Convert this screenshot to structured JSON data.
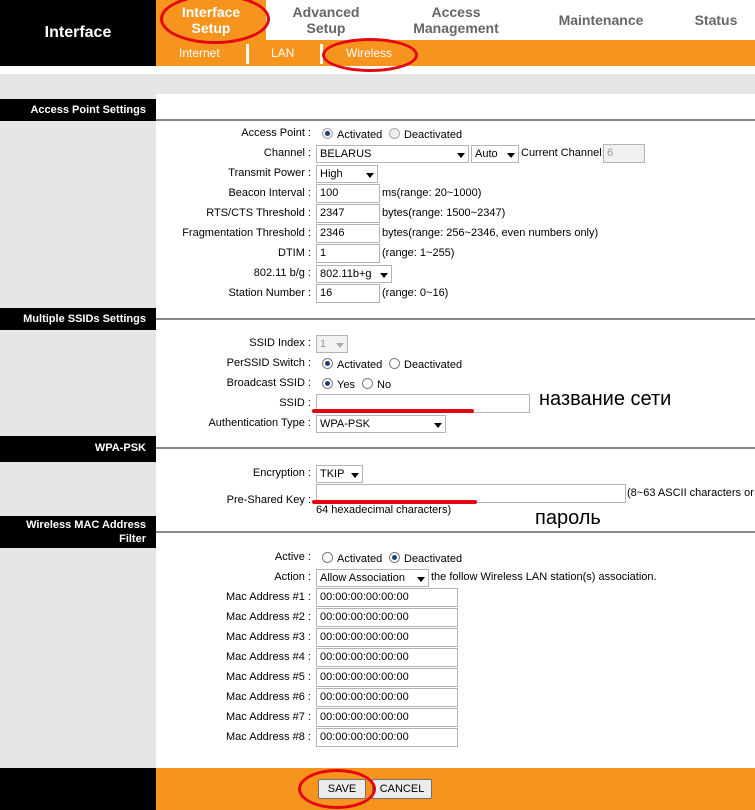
{
  "header": {
    "brand": "Interface",
    "tabs": [
      "Interface Setup",
      "Advanced Setup",
      "Access Management",
      "Maintenance",
      "Status"
    ],
    "tab_lines": [
      [
        "Interface",
        "Setup"
      ],
      [
        "Advanced",
        "Setup"
      ],
      [
        "Access",
        "Management"
      ],
      [
        "Maintenance"
      ],
      [
        "Status"
      ]
    ],
    "subtabs": [
      "Internet",
      "LAN",
      "Wireless"
    ]
  },
  "access_point": {
    "section_title": "Access Point Settings",
    "access_point_label": "Access Point :",
    "activated": "Activated",
    "deactivated": "Deactivated",
    "channel_label": "Channel :",
    "channel_region": "BELARUS",
    "channel_value": "Auto",
    "current_channel_label": "Current Channel:",
    "current_channel_value": "6",
    "transmit_power_label": "Transmit Power :",
    "transmit_power_value": "High",
    "beacon_label": "Beacon Interval :",
    "beacon_value": "100",
    "beacon_note": "ms(range: 20~1000)",
    "rts_label": "RTS/CTS Threshold :",
    "rts_value": "2347",
    "rts_note": "bytes(range: 1500~2347)",
    "frag_label": "Fragmentation Threshold :",
    "frag_value": "2346",
    "frag_note": "bytes(range: 256~2346, even numbers only)",
    "dtim_label": "DTIM :",
    "dtim_value": "1",
    "dtim_note": "(range: 1~255)",
    "mode_label": "802.11 b/g :",
    "mode_value": "802.11b+g",
    "station_label": "Station Number :",
    "station_value": "16",
    "station_note": "(range: 0~16)"
  },
  "ssid": {
    "section_title": "Multiple SSIDs Settings",
    "index_label": "SSID Index :",
    "index_value": "1",
    "switch_label": "PerSSID Switch :",
    "activated": "Activated",
    "deactivated": "Deactivated",
    "broadcast_label": "Broadcast SSID :",
    "yes": "Yes",
    "no": "No",
    "ssid_label": "SSID :",
    "ssid_value": "",
    "auth_label": "Authentication Type :",
    "auth_value": "WPA-PSK"
  },
  "wpa": {
    "section_title": "WPA-PSK",
    "encryption_label": "Encryption :",
    "encryption_value": "TKIP",
    "psk_label": "Pre-Shared Key :",
    "psk_value": "",
    "psk_note_1": "(8~63 ASCII characters or",
    "psk_note_2": "64 hexadecimal characters)"
  },
  "mac_filter": {
    "section_title_1": "Wireless MAC Address",
    "section_title_2": "Filter",
    "active_label": "Active :",
    "activated": "Activated",
    "deactivated": "Deactivated",
    "action_label": "Action :",
    "action_value": "Allow Association",
    "action_note": "the follow Wireless LAN station(s) association.",
    "addresses": [
      {
        "label": "Mac Address #1 :",
        "value": "00:00:00:00:00:00"
      },
      {
        "label": "Mac Address #2 :",
        "value": "00:00:00:00:00:00"
      },
      {
        "label": "Mac Address #3 :",
        "value": "00:00:00:00:00:00"
      },
      {
        "label": "Mac Address #4 :",
        "value": "00:00:00:00:00:00"
      },
      {
        "label": "Mac Address #5 :",
        "value": "00:00:00:00:00:00"
      },
      {
        "label": "Mac Address #6 :",
        "value": "00:00:00:00:00:00"
      },
      {
        "label": "Mac Address #7 :",
        "value": "00:00:00:00:00:00"
      },
      {
        "label": "Mac Address #8 :",
        "value": "00:00:00:00:00:00"
      }
    ]
  },
  "footer": {
    "save": "SAVE",
    "cancel": "CANCEL"
  },
  "annotations": {
    "ssid_note": "название сети",
    "psk_note": "пароль",
    "color": "#e30613"
  },
  "colors": {
    "accent": "#f7941e",
    "dark": "#000000",
    "panel": "#e6e6e6"
  }
}
